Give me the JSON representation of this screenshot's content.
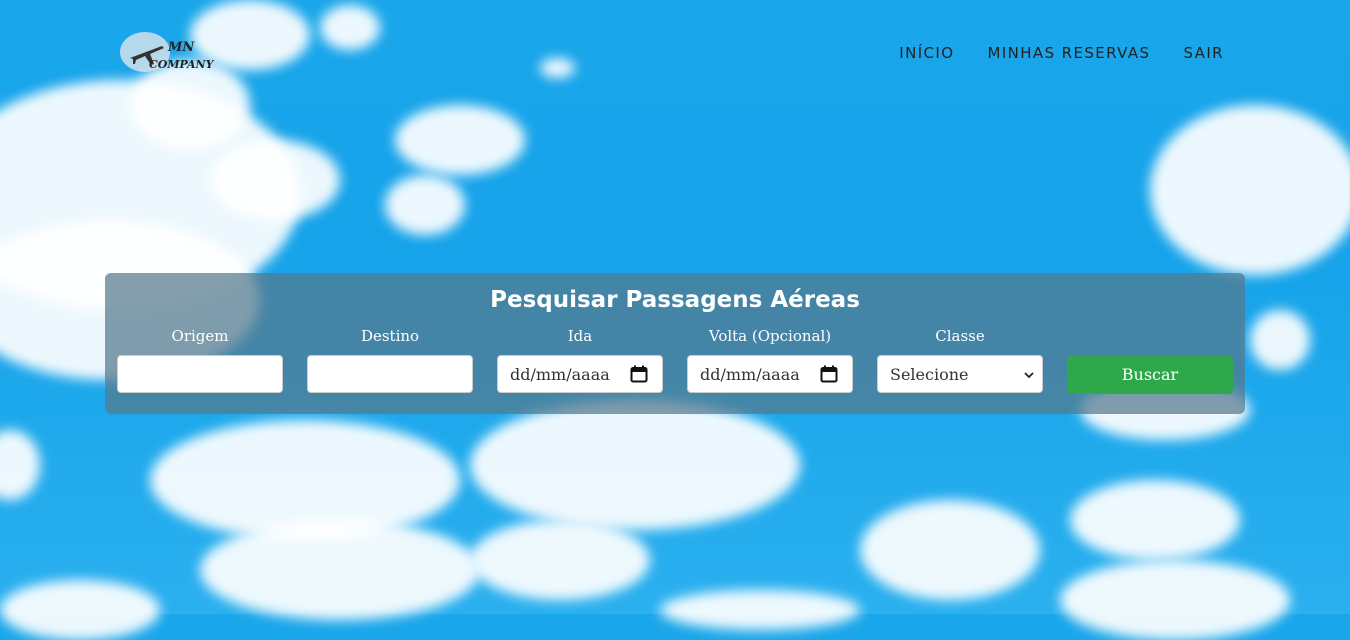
{
  "brand": {
    "logo_line1": "MN",
    "logo_line2": "COMPANY",
    "logo_icon": "airplane-icon"
  },
  "nav": {
    "items": [
      "INÍCIO",
      "MINHAS RESERVAS",
      "SAIR"
    ]
  },
  "search": {
    "title": "Pesquisar Passagens Aéreas",
    "fields": {
      "origem": {
        "label": "Origem",
        "value": ""
      },
      "destino": {
        "label": "Destino",
        "value": ""
      },
      "ida": {
        "label": "Ida",
        "placeholder": "dd/mm/aaaa"
      },
      "volta": {
        "label": "Volta (Opcional)",
        "placeholder": "dd/mm/aaaa"
      },
      "classe": {
        "label": "Classe",
        "selected": "Selecione"
      }
    },
    "button_label": "Buscar"
  },
  "colors": {
    "sky": "#1aa6ea",
    "panel": "#55788c",
    "button": "#2ea84a",
    "text_light": "#ffffff",
    "nav_text": "#222222"
  }
}
